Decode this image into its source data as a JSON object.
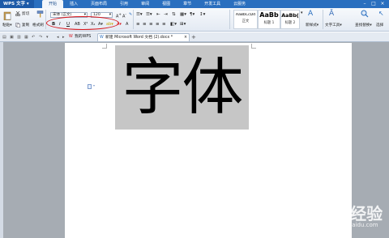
{
  "app": {
    "name": "WPS 文字"
  },
  "menu": {
    "tabs": [
      "开始",
      "插入",
      "页面布局",
      "引用",
      "审阅",
      "视图",
      "章节",
      "开发工具",
      "云服务"
    ],
    "active": 0
  },
  "ribbon": {
    "paste_label": "粘贴",
    "cut_label": "剪切",
    "copy_label": "复制",
    "format_painter_label": "格式刷",
    "font_name": "宋体 (正文)",
    "font_size": "120",
    "bold": "B",
    "italic": "I",
    "underline": "U",
    "styles": [
      {
        "sample": "AaBbCcDd",
        "name": "正文"
      },
      {
        "sample": "AaBb",
        "name": "标题 1"
      },
      {
        "sample": "AaBb(",
        "name": "标题 2"
      }
    ],
    "new_style_label": "新样式",
    "text_tools_label": "文字工具",
    "find_replace_label": "查找替换",
    "select_label": "选择"
  },
  "tabs": {
    "my_wps": "我的WPS",
    "document": "新建 Microsoft Word 文档 (2).docx *"
  },
  "document": {
    "content": "字体"
  },
  "watermark": {
    "brand": "Baidu经验",
    "url": "jingyan.baidu.com"
  },
  "colors": {
    "titlebar": "#2a6fbf",
    "annotation": "#d8141a",
    "selection": "#c6c6c6"
  }
}
